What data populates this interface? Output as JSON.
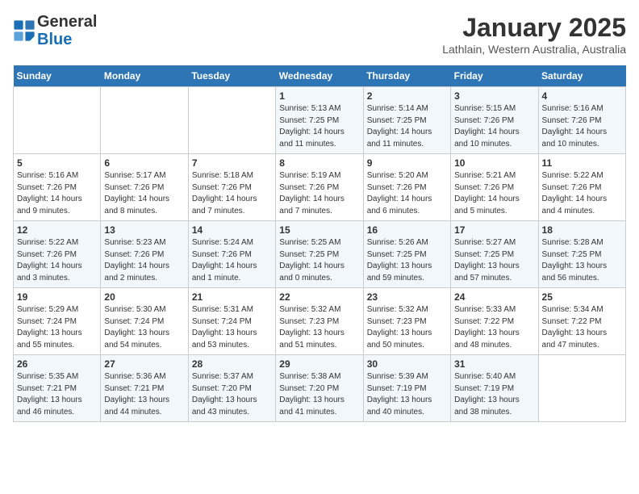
{
  "header": {
    "logo_general": "General",
    "logo_blue": "Blue",
    "month_title": "January 2025",
    "location": "Lathlain, Western Australia, Australia"
  },
  "weekdays": [
    "Sunday",
    "Monday",
    "Tuesday",
    "Wednesday",
    "Thursday",
    "Friday",
    "Saturday"
  ],
  "weeks": [
    [
      {
        "day": "",
        "info": ""
      },
      {
        "day": "",
        "info": ""
      },
      {
        "day": "",
        "info": ""
      },
      {
        "day": "1",
        "info": "Sunrise: 5:13 AM\nSunset: 7:25 PM\nDaylight: 14 hours and 11 minutes."
      },
      {
        "day": "2",
        "info": "Sunrise: 5:14 AM\nSunset: 7:25 PM\nDaylight: 14 hours and 11 minutes."
      },
      {
        "day": "3",
        "info": "Sunrise: 5:15 AM\nSunset: 7:26 PM\nDaylight: 14 hours and 10 minutes."
      },
      {
        "day": "4",
        "info": "Sunrise: 5:16 AM\nSunset: 7:26 PM\nDaylight: 14 hours and 10 minutes."
      }
    ],
    [
      {
        "day": "5",
        "info": "Sunrise: 5:16 AM\nSunset: 7:26 PM\nDaylight: 14 hours and 9 minutes."
      },
      {
        "day": "6",
        "info": "Sunrise: 5:17 AM\nSunset: 7:26 PM\nDaylight: 14 hours and 8 minutes."
      },
      {
        "day": "7",
        "info": "Sunrise: 5:18 AM\nSunset: 7:26 PM\nDaylight: 14 hours and 7 minutes."
      },
      {
        "day": "8",
        "info": "Sunrise: 5:19 AM\nSunset: 7:26 PM\nDaylight: 14 hours and 7 minutes."
      },
      {
        "day": "9",
        "info": "Sunrise: 5:20 AM\nSunset: 7:26 PM\nDaylight: 14 hours and 6 minutes."
      },
      {
        "day": "10",
        "info": "Sunrise: 5:21 AM\nSunset: 7:26 PM\nDaylight: 14 hours and 5 minutes."
      },
      {
        "day": "11",
        "info": "Sunrise: 5:22 AM\nSunset: 7:26 PM\nDaylight: 14 hours and 4 minutes."
      }
    ],
    [
      {
        "day": "12",
        "info": "Sunrise: 5:22 AM\nSunset: 7:26 PM\nDaylight: 14 hours and 3 minutes."
      },
      {
        "day": "13",
        "info": "Sunrise: 5:23 AM\nSunset: 7:26 PM\nDaylight: 14 hours and 2 minutes."
      },
      {
        "day": "14",
        "info": "Sunrise: 5:24 AM\nSunset: 7:26 PM\nDaylight: 14 hours and 1 minute."
      },
      {
        "day": "15",
        "info": "Sunrise: 5:25 AM\nSunset: 7:25 PM\nDaylight: 14 hours and 0 minutes."
      },
      {
        "day": "16",
        "info": "Sunrise: 5:26 AM\nSunset: 7:25 PM\nDaylight: 13 hours and 59 minutes."
      },
      {
        "day": "17",
        "info": "Sunrise: 5:27 AM\nSunset: 7:25 PM\nDaylight: 13 hours and 57 minutes."
      },
      {
        "day": "18",
        "info": "Sunrise: 5:28 AM\nSunset: 7:25 PM\nDaylight: 13 hours and 56 minutes."
      }
    ],
    [
      {
        "day": "19",
        "info": "Sunrise: 5:29 AM\nSunset: 7:24 PM\nDaylight: 13 hours and 55 minutes."
      },
      {
        "day": "20",
        "info": "Sunrise: 5:30 AM\nSunset: 7:24 PM\nDaylight: 13 hours and 54 minutes."
      },
      {
        "day": "21",
        "info": "Sunrise: 5:31 AM\nSunset: 7:24 PM\nDaylight: 13 hours and 53 minutes."
      },
      {
        "day": "22",
        "info": "Sunrise: 5:32 AM\nSunset: 7:23 PM\nDaylight: 13 hours and 51 minutes."
      },
      {
        "day": "23",
        "info": "Sunrise: 5:32 AM\nSunset: 7:23 PM\nDaylight: 13 hours and 50 minutes."
      },
      {
        "day": "24",
        "info": "Sunrise: 5:33 AM\nSunset: 7:22 PM\nDaylight: 13 hours and 48 minutes."
      },
      {
        "day": "25",
        "info": "Sunrise: 5:34 AM\nSunset: 7:22 PM\nDaylight: 13 hours and 47 minutes."
      }
    ],
    [
      {
        "day": "26",
        "info": "Sunrise: 5:35 AM\nSunset: 7:21 PM\nDaylight: 13 hours and 46 minutes."
      },
      {
        "day": "27",
        "info": "Sunrise: 5:36 AM\nSunset: 7:21 PM\nDaylight: 13 hours and 44 minutes."
      },
      {
        "day": "28",
        "info": "Sunrise: 5:37 AM\nSunset: 7:20 PM\nDaylight: 13 hours and 43 minutes."
      },
      {
        "day": "29",
        "info": "Sunrise: 5:38 AM\nSunset: 7:20 PM\nDaylight: 13 hours and 41 minutes."
      },
      {
        "day": "30",
        "info": "Sunrise: 5:39 AM\nSunset: 7:19 PM\nDaylight: 13 hours and 40 minutes."
      },
      {
        "day": "31",
        "info": "Sunrise: 5:40 AM\nSunset: 7:19 PM\nDaylight: 13 hours and 38 minutes."
      },
      {
        "day": "",
        "info": ""
      }
    ]
  ]
}
